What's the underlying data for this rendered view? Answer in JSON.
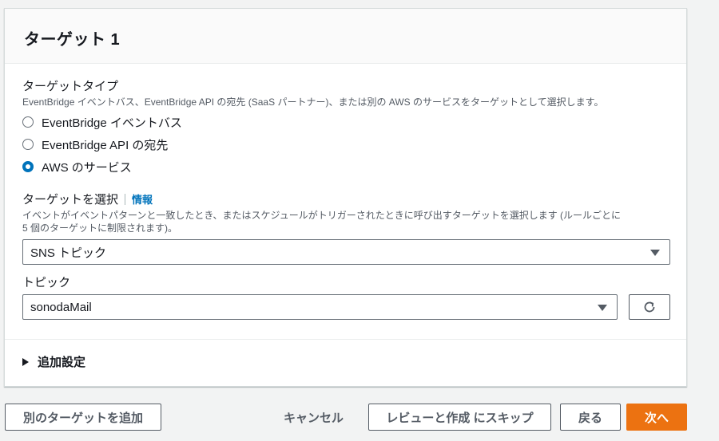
{
  "panel": {
    "title": "ターゲット 1"
  },
  "target_type": {
    "label": "ターゲットタイプ",
    "description": "EventBridge イベントバス、EventBridge API の宛先 (SaaS パートナー)、または別の AWS のサービスをターゲットとして選択します。",
    "options": [
      {
        "label": "EventBridge イベントバス",
        "checked": false
      },
      {
        "label": "EventBridge API の宛先",
        "checked": false
      },
      {
        "label": "AWS のサービス",
        "checked": true
      }
    ]
  },
  "select_target": {
    "label": "ターゲットを選択",
    "info_link": "情報",
    "description_line1": "イベントがイベントパターンと一致したとき、またはスケジュールがトリガーされたときに呼び出すターゲットを選択します (ルールごとに",
    "description_line2": "5 個のターゲットに制限されます)。",
    "value": "SNS トピック"
  },
  "topic": {
    "label": "トピック",
    "value": "sonodaMail"
  },
  "additional_settings": {
    "label": "追加設定"
  },
  "footer": {
    "add_target": "別のターゲットを追加",
    "cancel": "キャンセル",
    "skip_to_review": "レビューと作成 にスキップ",
    "back": "戻る",
    "next": "次へ"
  },
  "colors": {
    "accent": "#0073bb",
    "primary_button": "#ec7211",
    "background": "#f2f3f3"
  }
}
